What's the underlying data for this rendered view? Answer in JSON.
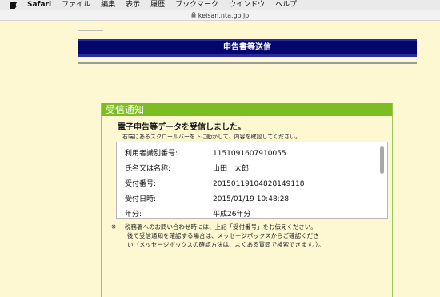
{
  "menubar": {
    "app_name": "Safari",
    "items": [
      "ファイル",
      "編集",
      "表示",
      "履歴",
      "ブックマーク",
      "ウインドウ",
      "ヘルプ"
    ]
  },
  "address_bar": {
    "url": "keisan.nta.go.jp"
  },
  "banner": {
    "title": "申告書等送信"
  },
  "receipt": {
    "header": "受信通知",
    "title": "電子申告等データを受信しました。",
    "subtitle": "右端にあるスクロールバーを下に動かして、内容を確認してください。",
    "rows": [
      {
        "label": "利用者識別番号:",
        "value": "1151091607910055"
      },
      {
        "label": "氏名又は名称:",
        "value": "山田　太郎"
      },
      {
        "label": "受付番号:",
        "value": "20150119104828149118"
      },
      {
        "label": "受付日時:",
        "value": "2015/01/19 10:48:28"
      },
      {
        "label": "年分:",
        "value": "平成26年分"
      }
    ],
    "note": {
      "mark": "※",
      "line1": "税務署へのお問い合わせ時には、上記「受付番号」をお伝えください。",
      "line2": "後で受信通知を確認する場合は、メッセージボックスからご確認くださ",
      "line3": "い（メッセージボックスの確認方法は、よくある質問で検索できます。）。"
    }
  },
  "colors": {
    "page_bg": "#fdf7d2",
    "banner_bg": "#06066f",
    "receipt_header_bg": "#7cbd21"
  }
}
